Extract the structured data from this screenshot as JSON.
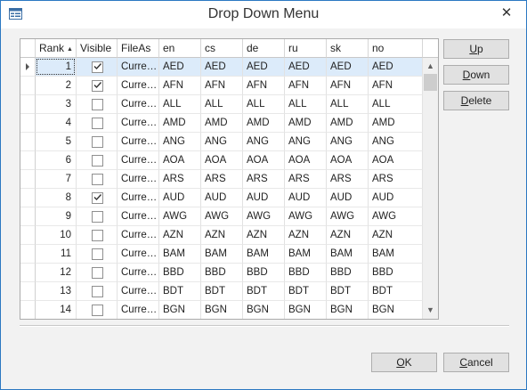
{
  "window": {
    "title": "Drop Down Menu",
    "close_glyph": "✕",
    "icon": "form-window-icon"
  },
  "grid": {
    "columns": {
      "rank": "Rank",
      "visible": "Visible",
      "fileas": "FileAs",
      "en": "en",
      "cs": "cs",
      "de": "de",
      "ru": "ru",
      "sk": "sk",
      "no": "no"
    },
    "sort": {
      "column": "Rank",
      "direction": "ascending"
    },
    "rows": [
      {
        "rank": "1",
        "visible": true,
        "fileas": "Curre…",
        "en": "AED",
        "cs": "AED",
        "de": "AED",
        "ru": "AED",
        "sk": "AED",
        "no": "AED"
      },
      {
        "rank": "2",
        "visible": true,
        "fileas": "Curre…",
        "en": "AFN",
        "cs": "AFN",
        "de": "AFN",
        "ru": "AFN",
        "sk": "AFN",
        "no": "AFN"
      },
      {
        "rank": "3",
        "visible": false,
        "fileas": "Curre…",
        "en": "ALL",
        "cs": "ALL",
        "de": "ALL",
        "ru": "ALL",
        "sk": "ALL",
        "no": "ALL"
      },
      {
        "rank": "4",
        "visible": false,
        "fileas": "Curre…",
        "en": "AMD",
        "cs": "AMD",
        "de": "AMD",
        "ru": "AMD",
        "sk": "AMD",
        "no": "AMD"
      },
      {
        "rank": "5",
        "visible": false,
        "fileas": "Curre…",
        "en": "ANG",
        "cs": "ANG",
        "de": "ANG",
        "ru": "ANG",
        "sk": "ANG",
        "no": "ANG"
      },
      {
        "rank": "6",
        "visible": false,
        "fileas": "Curre…",
        "en": "AOA",
        "cs": "AOA",
        "de": "AOA",
        "ru": "AOA",
        "sk": "AOA",
        "no": "AOA"
      },
      {
        "rank": "7",
        "visible": false,
        "fileas": "Curre…",
        "en": "ARS",
        "cs": "ARS",
        "de": "ARS",
        "ru": "ARS",
        "sk": "ARS",
        "no": "ARS"
      },
      {
        "rank": "8",
        "visible": true,
        "fileas": "Curre…",
        "en": "AUD",
        "cs": "AUD",
        "de": "AUD",
        "ru": "AUD",
        "sk": "AUD",
        "no": "AUD"
      },
      {
        "rank": "9",
        "visible": false,
        "fileas": "Curre…",
        "en": "AWG",
        "cs": "AWG",
        "de": "AWG",
        "ru": "AWG",
        "sk": "AWG",
        "no": "AWG"
      },
      {
        "rank": "10",
        "visible": false,
        "fileas": "Curre…",
        "en": "AZN",
        "cs": "AZN",
        "de": "AZN",
        "ru": "AZN",
        "sk": "AZN",
        "no": "AZN"
      },
      {
        "rank": "11",
        "visible": false,
        "fileas": "Curre…",
        "en": "BAM",
        "cs": "BAM",
        "de": "BAM",
        "ru": "BAM",
        "sk": "BAM",
        "no": "BAM"
      },
      {
        "rank": "12",
        "visible": false,
        "fileas": "Curre…",
        "en": "BBD",
        "cs": "BBD",
        "de": "BBD",
        "ru": "BBD",
        "sk": "BBD",
        "no": "BBD"
      },
      {
        "rank": "13",
        "visible": false,
        "fileas": "Curre…",
        "en": "BDT",
        "cs": "BDT",
        "de": "BDT",
        "ru": "BDT",
        "sk": "BDT",
        "no": "BDT"
      },
      {
        "rank": "14",
        "visible": false,
        "fileas": "Curre…",
        "en": "BGN",
        "cs": "BGN",
        "de": "BGN",
        "ru": "BGN",
        "sk": "BGN",
        "no": "BGN"
      }
    ],
    "selected_row": 0
  },
  "side_buttons": {
    "up": "Up",
    "down": "Down",
    "delete": "Delete"
  },
  "footer_buttons": {
    "ok": "OK",
    "cancel": "Cancel"
  },
  "colors": {
    "selection": "#dcebfa",
    "border_accent": "#2b78c2"
  }
}
